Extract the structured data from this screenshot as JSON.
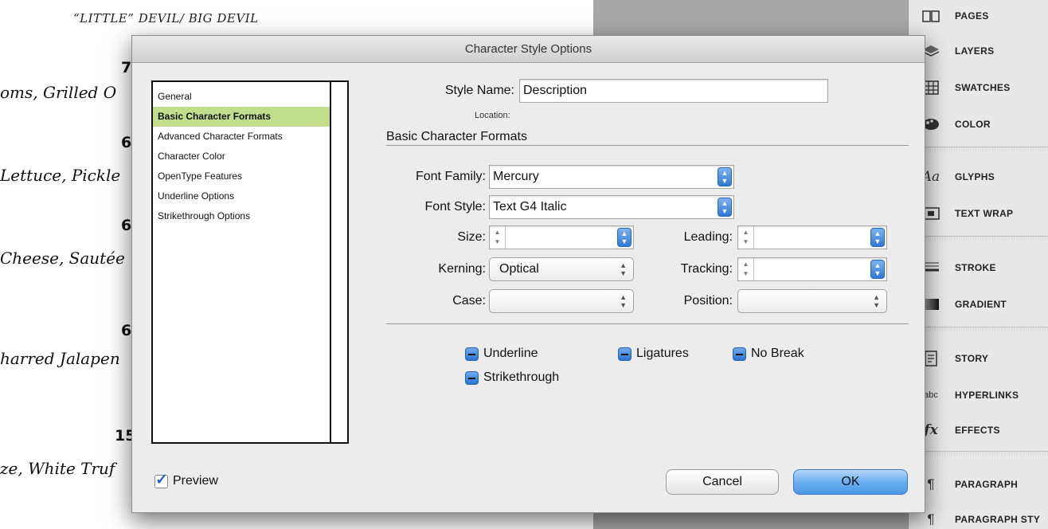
{
  "document": {
    "title": "“LITTLE” DEVIL/ BIG DEVIL",
    "rows": [
      {
        "price": "7.",
        "desc": "oms, Grilled O"
      },
      {
        "price": "6.",
        "desc": "Lettuce, Pickle"
      },
      {
        "price": "6.",
        "desc": "Cheese, Sautée"
      },
      {
        "price": "6.",
        "desc": "harred Jalapen"
      },
      {
        "price": "15.",
        "desc": "ze, White Truf"
      }
    ]
  },
  "dock": {
    "items": [
      {
        "label": "PAGES",
        "icon": "pages-icon"
      },
      {
        "label": "LAYERS",
        "icon": "layers-icon"
      },
      {
        "label": "SWATCHES",
        "icon": "swatches-icon"
      },
      {
        "label": "COLOR",
        "icon": "color-icon"
      },
      {
        "label": "GLYPHS",
        "icon": "glyphs-icon"
      },
      {
        "label": "TEXT WRAP",
        "icon": "text-wrap-icon"
      },
      {
        "label": "STROKE",
        "icon": "stroke-icon"
      },
      {
        "label": "GRADIENT",
        "icon": "gradient-icon"
      },
      {
        "label": "STORY",
        "icon": "story-icon"
      },
      {
        "label": "HYPERLINKS",
        "icon": "hyperlinks-icon"
      },
      {
        "label": "EFFECTS",
        "icon": "effects-icon"
      },
      {
        "label": "PARAGRAPH",
        "icon": "paragraph-icon"
      },
      {
        "label": "PARAGRAPH STY",
        "icon": "paragraph-styles-icon"
      }
    ]
  },
  "dialog": {
    "title": "Character Style Options",
    "categories": [
      "General",
      "Basic Character Formats",
      "Advanced Character Formats",
      "Character Color",
      "OpenType Features",
      "Underline Options",
      "Strikethrough Options"
    ],
    "selected_category": "Basic Character Formats",
    "style_name_label": "Style Name:",
    "style_name_value": "Description",
    "location_label": "Location:",
    "section_title": "Basic Character Formats",
    "font_family_label": "Font Family:",
    "font_family_value": "Mercury",
    "font_style_label": "Font Style:",
    "font_style_value": "Text G4 Italic",
    "size_label": "Size:",
    "size_value": "",
    "leading_label": "Leading:",
    "leading_value": "",
    "kerning_label": "Kerning:",
    "kerning_value": "Optical",
    "tracking_label": "Tracking:",
    "tracking_value": "",
    "case_label": "Case:",
    "case_value": "",
    "position_label": "Position:",
    "position_value": "",
    "underline_label": "Underline",
    "ligatures_label": "Ligatures",
    "no_break_label": "No Break",
    "strikethrough_label": "Strikethrough",
    "preview_label": "Preview",
    "preview_checked": true,
    "cancel_label": "Cancel",
    "ok_label": "OK"
  }
}
